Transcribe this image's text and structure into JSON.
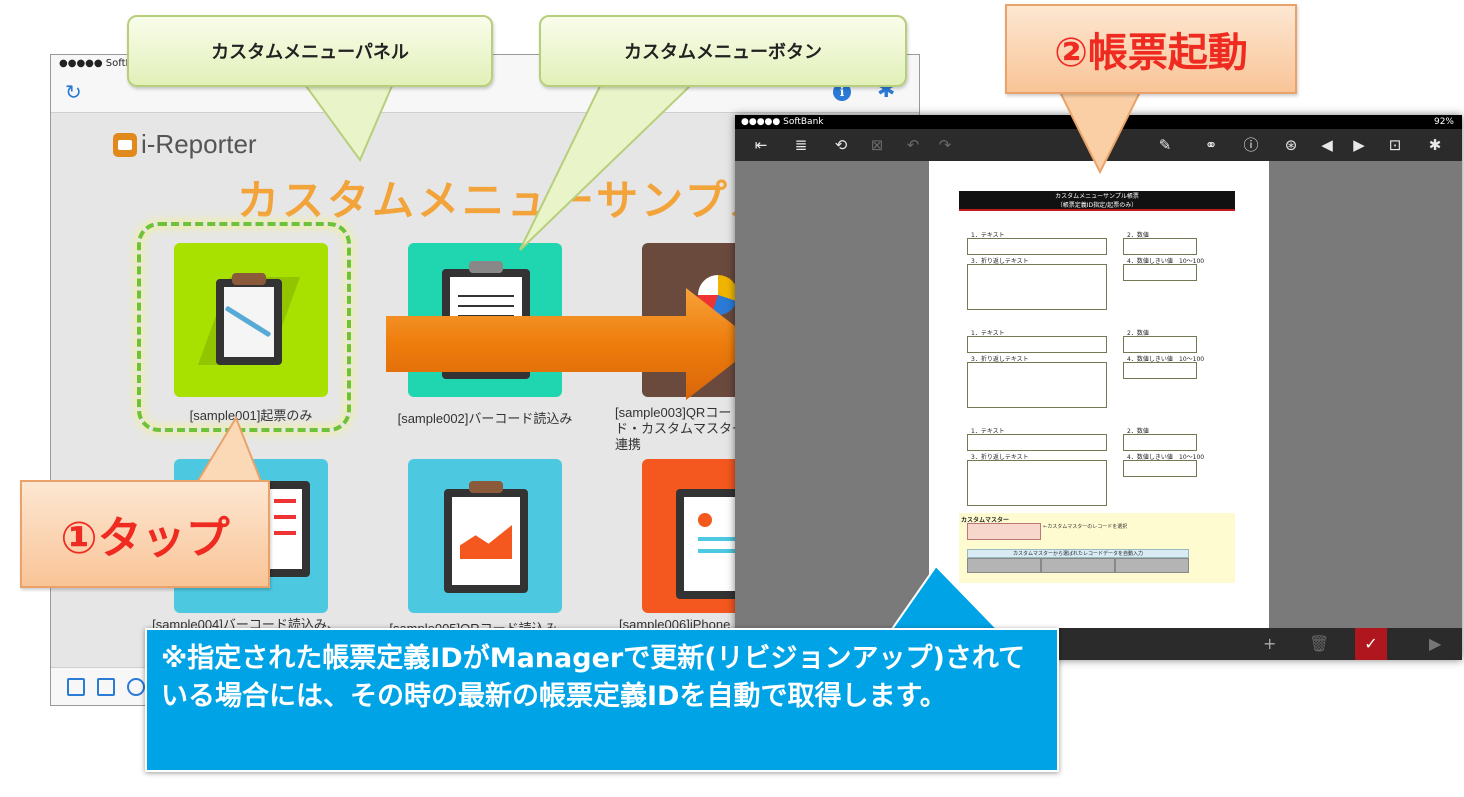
{
  "left_app": {
    "status_carrier": "●●●●● SoftBank",
    "logo_text": "i-Reporter",
    "menu_title": "カスタムメニューサンプル",
    "tiles": [
      {
        "label": "[sample001]起票のみ",
        "color": "#a8e000"
      },
      {
        "label": "[sample002]バーコード読込み",
        "color": "#1fd6b0"
      },
      {
        "label": "[sample003]QRコード・カスタムマスター連携",
        "color": "#6b4a3e"
      },
      {
        "label": "[sample004]バーコード読込み、",
        "color": "#4cc9e0"
      },
      {
        "label": "[sample005]QRコード読込み、カスタ",
        "color": "#4cc9e0"
      },
      {
        "label": "[sample006]iPhone用",
        "color": "#f4581e"
      }
    ]
  },
  "right_app": {
    "status_carrier": "●●●●● SoftBank",
    "status_battery": "92%",
    "sheet": {
      "title": "カスタムメニューサンプル帳票",
      "subtitle": "（帳票定義ID指定/起票のみ）",
      "field_text": "1．テキスト",
      "field_number": "2．数値",
      "field_wrap": "3．折り返しテキスト",
      "field_threshold": "4．数値しきい値",
      "threshold_range": "10～100",
      "master_title": "カスタムマスター",
      "master_hint": "←カスタムマスターのレコードを選択",
      "master_header": "カスタムマスターから選ばれたレコードデータを自動入力"
    }
  },
  "callouts": {
    "panel": "カスタムメニューパネル",
    "button": "カスタムメニューボタン",
    "tap": "①タップ",
    "launch": "②帳票起動",
    "note": "※指定された帳票定義IDがManagerで更新(リビジョンアップ)されている場合には、その時の最新の帳票定義IDを自動で取得します。"
  },
  "colors": {
    "accent_blue": "#2a7ad6",
    "arrow_orange": "#f28a12",
    "note_blue": "#00a4e6",
    "callout_red_text": "#ef2a20"
  }
}
